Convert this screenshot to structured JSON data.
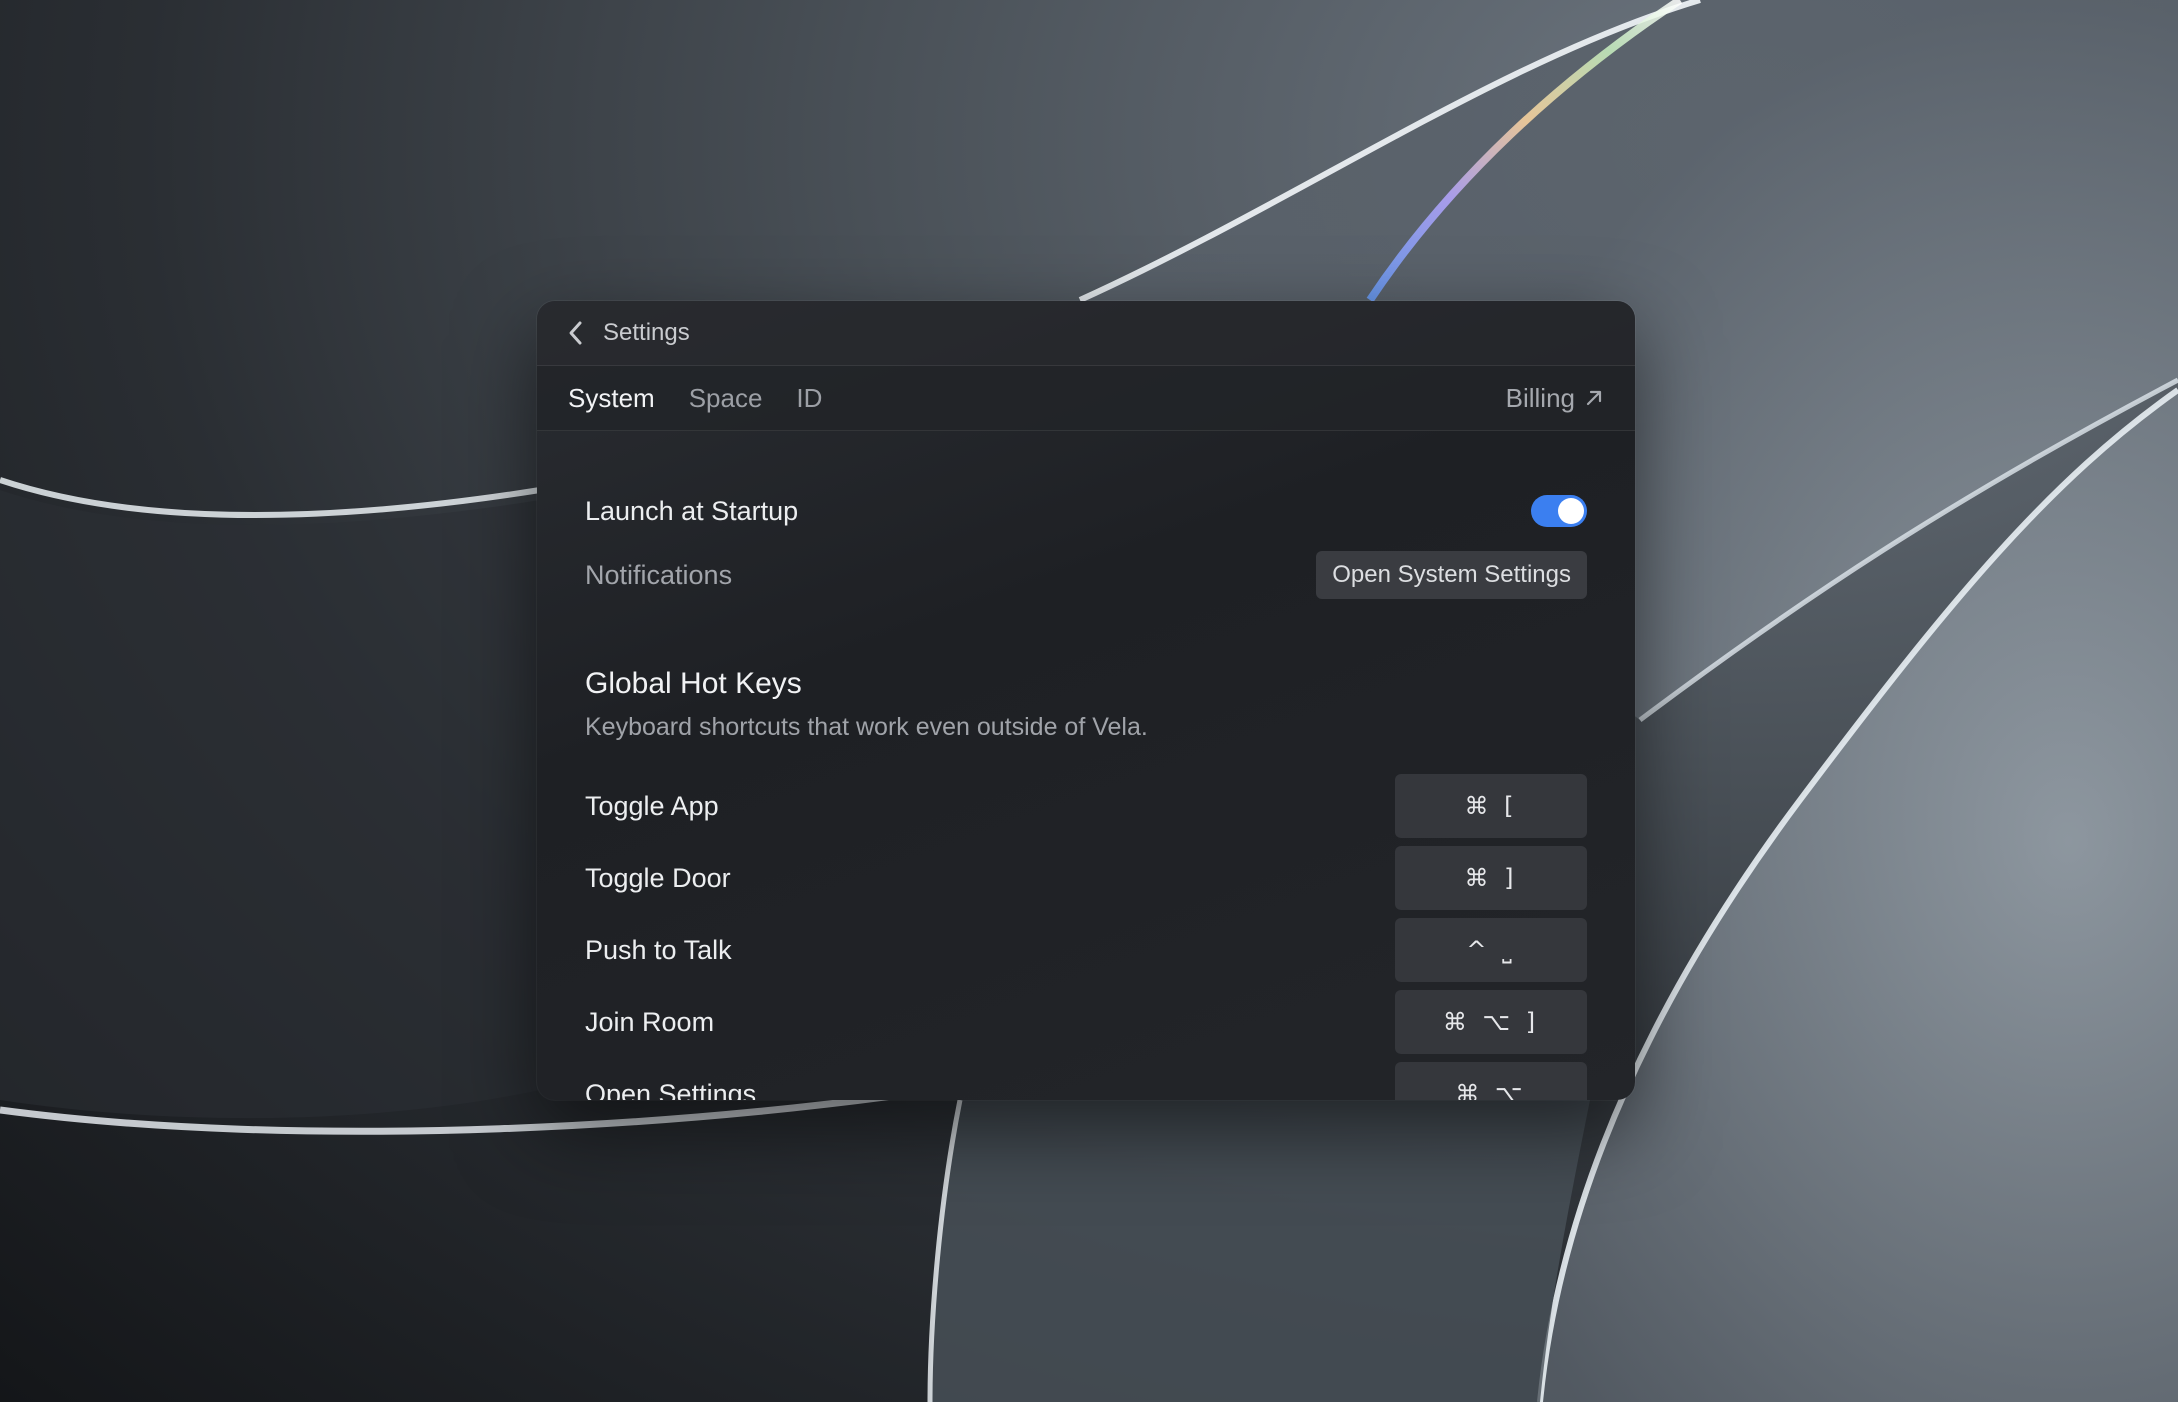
{
  "window": {
    "title": "Settings"
  },
  "tabs": [
    {
      "label": "System",
      "active": true
    },
    {
      "label": "Space",
      "active": false
    },
    {
      "label": "ID",
      "active": false
    }
  ],
  "billing": {
    "label": "Billing",
    "icon": "external-arrow-icon"
  },
  "general": {
    "launch_label": "Launch at Startup",
    "launch_enabled": true,
    "notifications_label": "Notifications",
    "open_settings_button": "Open System Settings"
  },
  "hotkeys": {
    "title": "Global Hot Keys",
    "description": "Keyboard shortcuts that work even outside of Vela.",
    "items": [
      {
        "label": "Toggle App",
        "keys": "⌘ ["
      },
      {
        "label": "Toggle Door",
        "keys": "⌘ ]"
      },
      {
        "label": "Push to Talk",
        "keys": "^ ⎵"
      },
      {
        "label": "Join Room",
        "keys": "⌘ ⌥ ]"
      },
      {
        "label": "Open Settings",
        "keys": "⌘ ⌥"
      }
    ]
  },
  "colors": {
    "accent": "#3b7ff0",
    "window_bg": "#1e2024",
    "key_bg": "#35373c"
  }
}
